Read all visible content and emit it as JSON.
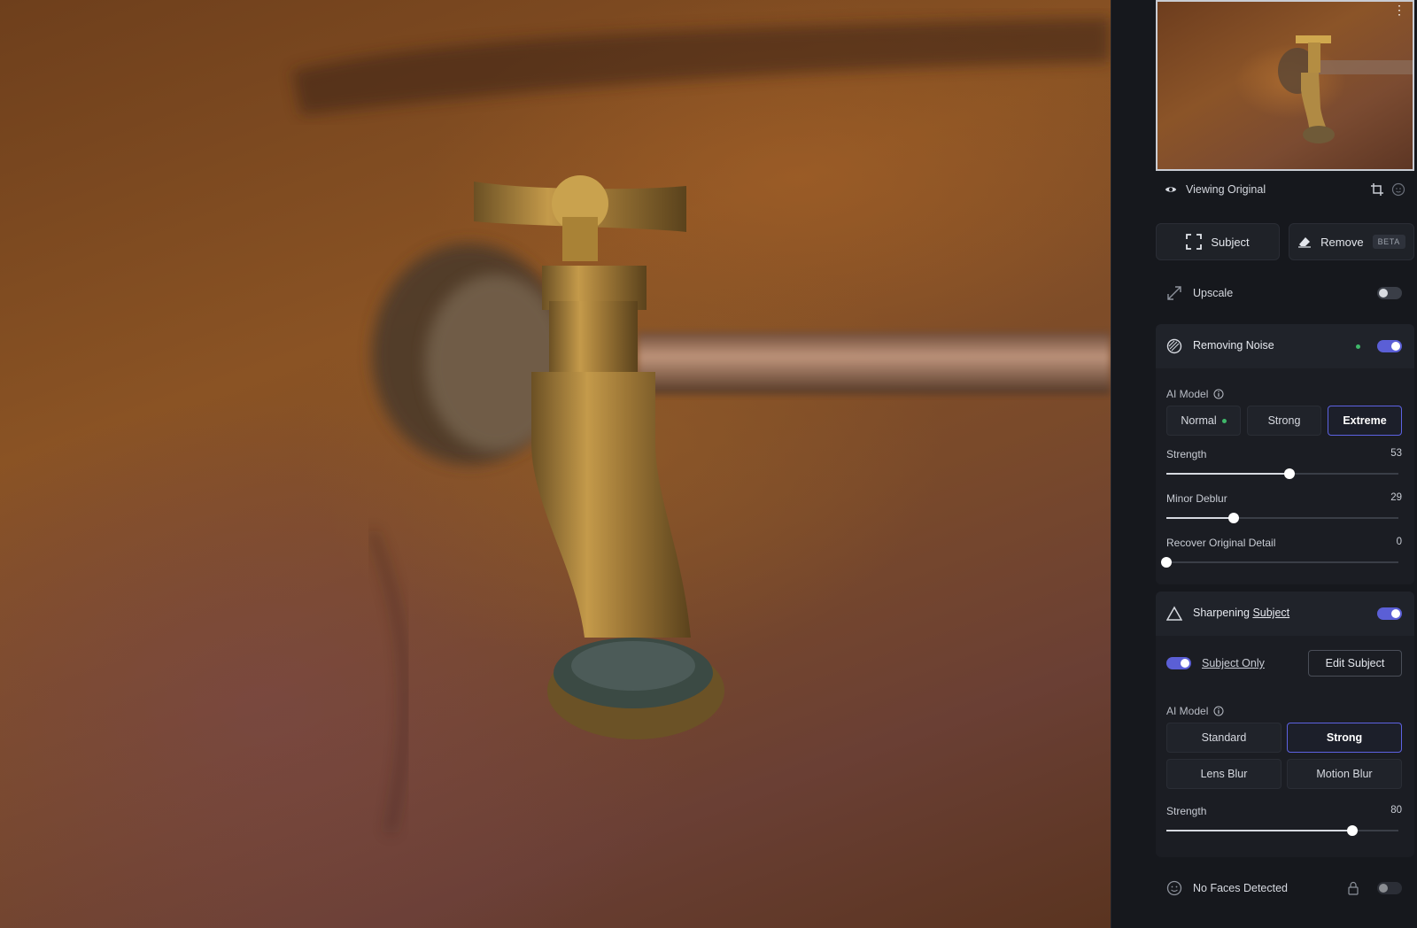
{
  "viewing": {
    "label": "Viewing Original"
  },
  "modes": {
    "subject_label": "Subject",
    "remove_label": "Remove",
    "beta_badge": "BETA"
  },
  "upscale": {
    "label": "Upscale",
    "enabled": false
  },
  "noise": {
    "title": "Removing Noise",
    "enabled": true,
    "ai_model_label": "AI Model",
    "models": [
      "Normal",
      "Strong",
      "Extreme"
    ],
    "selected_model": "Extreme",
    "sliders": [
      {
        "label": "Strength",
        "value": 53,
        "max": 100
      },
      {
        "label": "Minor Deblur",
        "value": 29,
        "max": 100
      },
      {
        "label": "Recover Original Detail",
        "value": 0,
        "max": 100
      }
    ]
  },
  "sharpen": {
    "title_prefix": "Sharpening",
    "title_link": "Subject",
    "enabled": true,
    "subject_only_label": "Subject Only",
    "subject_only": true,
    "edit_subject_label": "Edit Subject",
    "ai_model_label": "AI Model",
    "models": [
      "Standard",
      "Strong",
      "Lens Blur",
      "Motion Blur"
    ],
    "selected_model": "Strong",
    "strength": {
      "label": "Strength",
      "value": 80,
      "max": 100
    }
  },
  "faces": {
    "label": "No Faces Detected",
    "enabled": false
  },
  "colors": {
    "accent": "#5b5fd6",
    "status_green": "#3fb86a"
  }
}
